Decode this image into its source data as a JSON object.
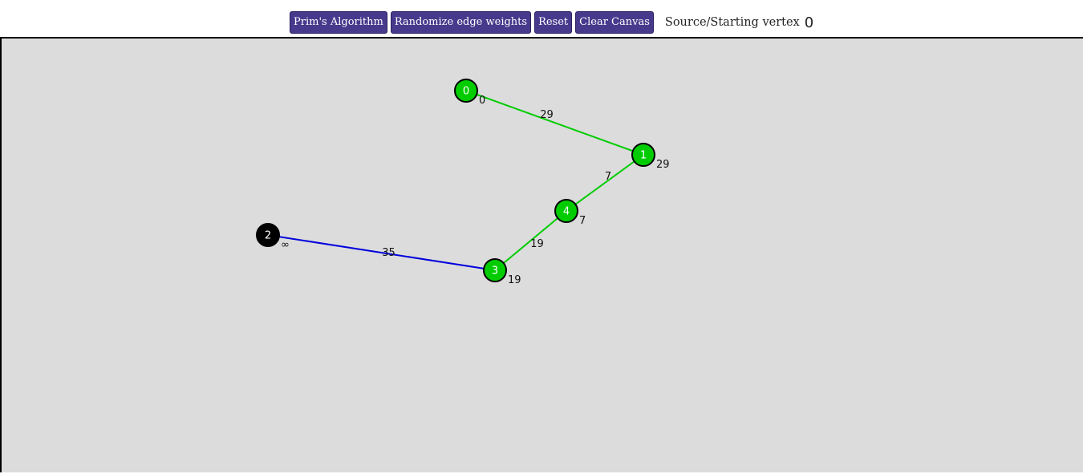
{
  "page": {
    "title_fragment": ""
  },
  "toolbar": {
    "prims_label": "Prim's Algorithm",
    "randomize_label": "Randomize edge weights",
    "reset_label": "Reset",
    "clear_label": "Clear Canvas",
    "source_label": "Source/Starting vertex",
    "source_value": "0"
  },
  "colors": {
    "button_bg": "#473a8c",
    "canvas_bg": "#dcdcdc",
    "in_tree": "#00cc00",
    "candidate_edge": "#0000dd",
    "unvisited": "#000000"
  },
  "graph": {
    "vertices": [
      {
        "id": "0",
        "dist": "0",
        "state": "in_tree"
      },
      {
        "id": "1",
        "dist": "29",
        "state": "in_tree"
      },
      {
        "id": "2",
        "dist": "∞",
        "state": "unvisited"
      },
      {
        "id": "3",
        "dist": "19",
        "state": "in_tree"
      },
      {
        "id": "4",
        "dist": "7",
        "state": "in_tree"
      }
    ],
    "edges": [
      {
        "from": "0",
        "to": "1",
        "weight": "29",
        "state": "in_tree"
      },
      {
        "from": "1",
        "to": "4",
        "weight": "7",
        "state": "in_tree"
      },
      {
        "from": "4",
        "to": "3",
        "weight": "19",
        "state": "in_tree"
      },
      {
        "from": "2",
        "to": "3",
        "weight": "35",
        "state": "candidate"
      }
    ]
  }
}
